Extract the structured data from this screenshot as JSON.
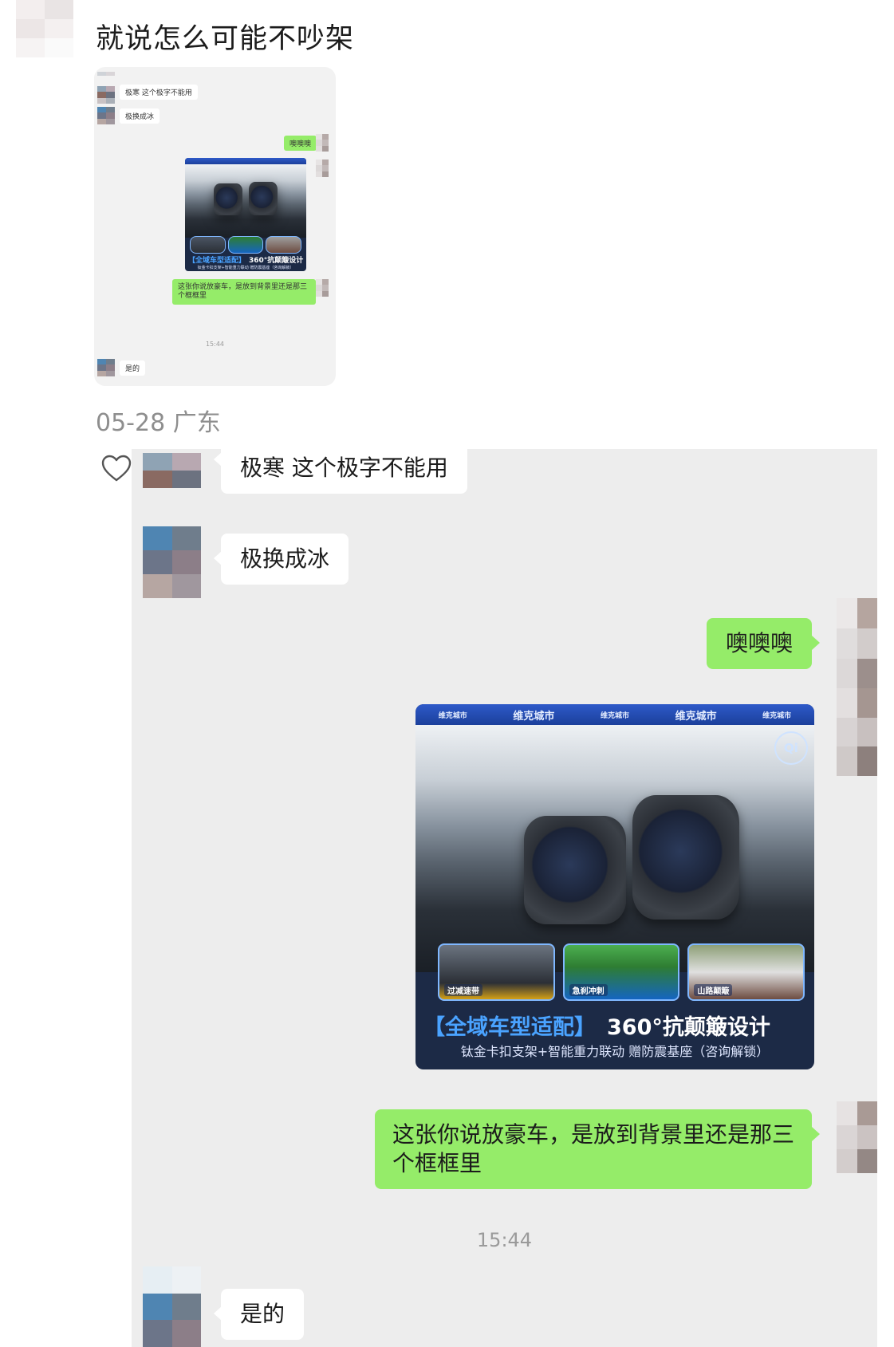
{
  "post": {
    "text": "就说怎么可能不吵架",
    "meta": "05-28 广东"
  },
  "chat": {
    "messages": [
      {
        "side": "left",
        "text": "极寒 这个极字不能用"
      },
      {
        "side": "left",
        "text": "极换成冰"
      },
      {
        "side": "right",
        "text": "噢噢噢"
      },
      {
        "side": "right",
        "type": "image"
      },
      {
        "side": "right",
        "text": "这张你说放豪车，是放到背景里还是那三个框框里",
        "line1": "这张你说放豪车，是放到背景里还是那三",
        "line2": "个框框里"
      },
      {
        "side": "left",
        "text": "是的"
      }
    ],
    "timestamp": "15:44"
  },
  "product_image": {
    "tab_labels": [
      "维克城市",
      "维克城市",
      "维克城市",
      "维克城市",
      "维克城市"
    ],
    "slogan_highlight": "【全域车型适配】",
    "slogan_main": "360°抗颠簸设计",
    "subtitle": "钛金卡扣支架+智能重力联动 赠防震基座（咨询解锁）",
    "car_labels": [
      "过减速带",
      "急刹冲刺",
      "山路颠簸"
    ],
    "badge": "Qi"
  },
  "icons": {
    "like": "heart-outline-icon"
  },
  "colors": {
    "chat_bg": "#ededed",
    "sent_bubble": "#95ec69",
    "received_bubble": "#ffffff",
    "meta_text": "#8e8e8e"
  }
}
